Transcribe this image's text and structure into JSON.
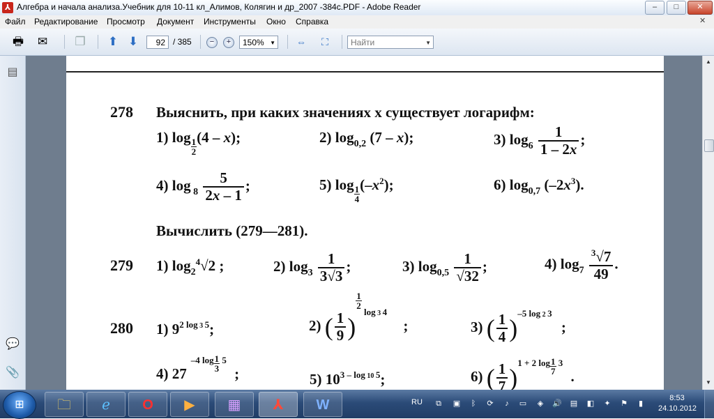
{
  "window": {
    "title": "Алгебра и начала анализа.Учебник для 10-11 кл_Алимов, Колягин и др_2007 -384с.PDF - Adobe Reader",
    "minimize": "–",
    "maximize": "□",
    "close": "✕"
  },
  "menu": [
    "Файл",
    "Редактирование",
    "Просмотр",
    "Документ",
    "Инструменты",
    "Окно",
    "Справка"
  ],
  "toolbar": {
    "page_current": "92",
    "page_total": "/ 385",
    "zoom": "150%",
    "search_placeholder": "Найти"
  },
  "document": {
    "p278_number": "278",
    "p278_task": "Выяснить, при каких значениях x существует логарифм:",
    "section": "Вычислить (279—281).",
    "p279_number": "279",
    "p280_number": "280",
    "labels": [
      "1)",
      "2)",
      "3)",
      "4)",
      "5)",
      "6)"
    ]
  },
  "taskbar": {
    "language": "RU",
    "time": "8:53",
    "date": "24.10.2012"
  },
  "colors": {
    "titlebar": "#dfe9f5",
    "taskbar": "#2b4b78",
    "doc_background": "#6f7d8e",
    "close_button": "#c8442b"
  }
}
